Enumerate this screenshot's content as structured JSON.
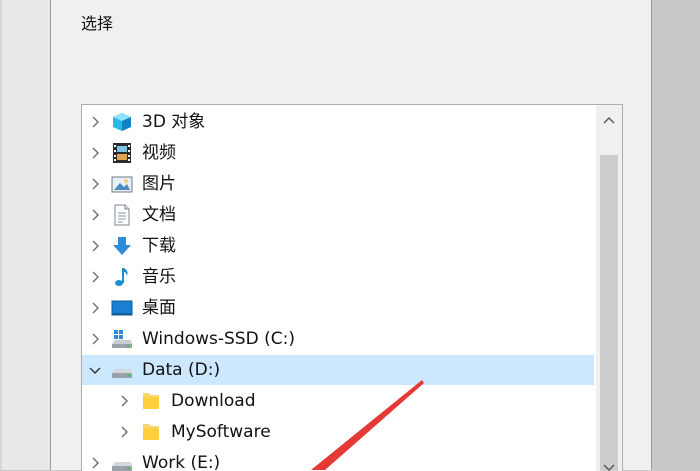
{
  "dialog": {
    "prompt": "选择"
  },
  "tree": {
    "items": [
      {
        "label": "3D 对象",
        "icon": "3d-objects-icon",
        "expanded": false,
        "indent": 0,
        "selected": false
      },
      {
        "label": "视频",
        "icon": "videos-icon",
        "expanded": false,
        "indent": 0,
        "selected": false
      },
      {
        "label": "图片",
        "icon": "pictures-icon",
        "expanded": false,
        "indent": 0,
        "selected": false
      },
      {
        "label": "文档",
        "icon": "documents-icon",
        "expanded": false,
        "indent": 0,
        "selected": false
      },
      {
        "label": "下载",
        "icon": "downloads-icon",
        "expanded": false,
        "indent": 0,
        "selected": false
      },
      {
        "label": "音乐",
        "icon": "music-icon",
        "expanded": false,
        "indent": 0,
        "selected": false
      },
      {
        "label": "桌面",
        "icon": "desktop-icon",
        "expanded": false,
        "indent": 0,
        "selected": false
      },
      {
        "label": "Windows-SSD (C:)",
        "icon": "system-drive-icon",
        "expanded": false,
        "indent": 0,
        "selected": false
      },
      {
        "label": "Data (D:)",
        "icon": "drive-icon",
        "expanded": true,
        "indent": 0,
        "selected": true
      },
      {
        "label": "Download",
        "icon": "folder-icon",
        "expanded": false,
        "indent": 1,
        "selected": false
      },
      {
        "label": "MySoftware",
        "icon": "folder-icon",
        "expanded": false,
        "indent": 1,
        "selected": false
      },
      {
        "label": "Work (E:)",
        "icon": "drive-icon",
        "expanded": false,
        "indent": 0,
        "selected": false
      }
    ]
  },
  "colors": {
    "selection": "#cce8ff",
    "annotation_arrow": "#e53935",
    "accent": "#2e8bd8"
  }
}
